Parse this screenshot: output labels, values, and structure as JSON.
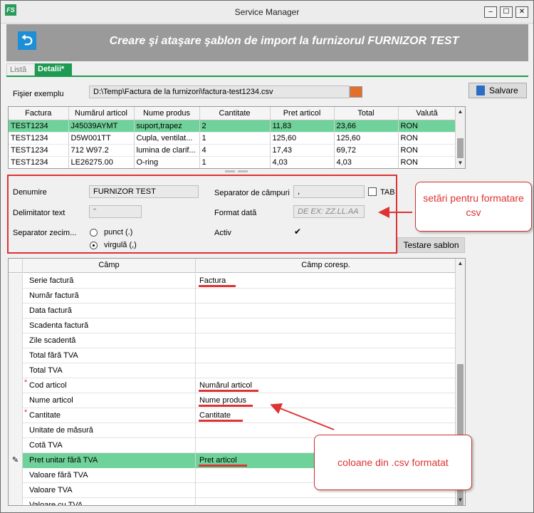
{
  "window": {
    "title": "Service Manager",
    "app_icon": "FS",
    "controls": [
      "–",
      "☐",
      "✕"
    ]
  },
  "banner": {
    "title": "Creare şi ataşare şablon de import la furnizorul FURNIZOR TEST",
    "icon": "back-arrow-icon",
    "color": "#9a9a9a"
  },
  "tabs": [
    {
      "label": "Listă",
      "active": false
    },
    {
      "label": "Detalii*",
      "active": true
    }
  ],
  "file": {
    "label": "Fişier exemplu",
    "value": "D:\\Temp\\Factura de la furnizori\\factura-test1234.csv"
  },
  "save_button": "Salvare",
  "preview_grid": {
    "columns": [
      "Factura",
      "Numărul articol",
      "Nume produs",
      "Cantitate",
      "Pret articol",
      "Total",
      "Valută"
    ],
    "rows": [
      [
        "TEST1234",
        "J45039AYMT",
        "suport,trapez",
        "2",
        "11,83",
        "23,66",
        "RON"
      ],
      [
        "TEST1234",
        "D5W001TT",
        "Cupla, ventilat...",
        "1",
        "125,60",
        "125,60",
        "RON"
      ],
      [
        "TEST1234",
        "712 W97.2",
        "lumina de clarif...",
        "4",
        "17,43",
        "69,72",
        "RON"
      ],
      [
        "TEST1234",
        "LE26275.00",
        "O-ring",
        "1",
        "4,03",
        "4,03",
        "RON"
      ]
    ],
    "selected_row": 0
  },
  "settings": {
    "name_label": "Denumire",
    "name_value": "FURNIZOR TEST",
    "text_delim_label": "Delimitator text",
    "text_delim_value": "\"",
    "decimal_sep_label": "Separator zecim...",
    "decimal_options": [
      {
        "label": "punct (.)",
        "selected": false
      },
      {
        "label": "virgulă (,)",
        "selected": true
      }
    ],
    "field_sep_label": "Separator de câmpuri",
    "field_sep_value": ",",
    "tab_label": "TAB",
    "tab_checked": false,
    "date_format_label": "Format dată",
    "date_format_placeholder": "DE EX: ZZ.LL.AA",
    "active_label": "Activ",
    "active_checked": true
  },
  "test_button": "Testare sablon",
  "annotations": {
    "settings_callout": "setări pentru formatare csv",
    "columns_callout": "coloane din .csv formatat",
    "color": "#d33333"
  },
  "mapping_grid": {
    "columns": [
      "Câmp",
      "Câmp coresp."
    ],
    "rows": [
      {
        "field": "Serie factură",
        "mapped": "Factura",
        "required": false
      },
      {
        "field": "Număr factură",
        "mapped": "",
        "required": false
      },
      {
        "field": "Data factură",
        "mapped": "",
        "required": false
      },
      {
        "field": "Scadenta factură",
        "mapped": "",
        "required": false
      },
      {
        "field": "Zile scadentă",
        "mapped": "",
        "required": false
      },
      {
        "field": "Total fără TVA",
        "mapped": "",
        "required": false
      },
      {
        "field": "Total TVA",
        "mapped": "",
        "required": false
      },
      {
        "field": "Cod articol",
        "mapped": "Numărul articol",
        "required": true
      },
      {
        "field": "Nume articol",
        "mapped": "Nume produs",
        "required": false
      },
      {
        "field": "Cantitate",
        "mapped": "Cantitate",
        "required": true
      },
      {
        "field": "Unitate de măsură",
        "mapped": "",
        "required": false
      },
      {
        "field": "Cotă TVA",
        "mapped": "",
        "required": false
      },
      {
        "field": "Pret unitar fără TVA",
        "mapped": "Pret articol",
        "required": false,
        "selected": true
      },
      {
        "field": "Valoare fără TVA",
        "mapped": "",
        "required": false
      },
      {
        "field": "Valoare TVA",
        "mapped": "",
        "required": false
      },
      {
        "field": "Valoare cu TVA",
        "mapped": "",
        "required": false
      }
    ],
    "required_mark": "*",
    "edit_indicator": "✎"
  }
}
